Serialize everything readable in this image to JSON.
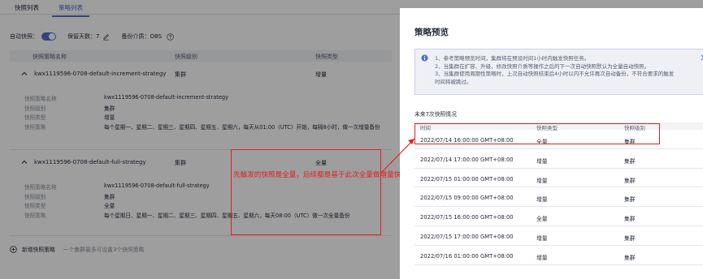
{
  "tabs": [
    {
      "label": "快照列表"
    },
    {
      "label": "策略列表"
    }
  ],
  "settings": {
    "auto_label": "自动快照：",
    "keep_label": "保留天数：",
    "keep_value": "7",
    "medium_label": "备份介质：",
    "medium_value": "OBS"
  },
  "table_header": {
    "name": "快照策略名称",
    "level": "快照级别",
    "type": "快照类型"
  },
  "groups": [
    {
      "name": "kwx1119596-0708-default-increment-strategy",
      "level": "集群",
      "type": "增量",
      "details": [
        {
          "k": "快照策略名称",
          "v": "kwx1119596-0708-default-increment-strategy"
        },
        {
          "k": "快照级别",
          "v": "集群"
        },
        {
          "k": "快照类型",
          "v": "增量"
        },
        {
          "k": "快照策略",
          "v": "每个星期一、星期二、星期三、星期四、星期五、星期六，每天从01:00（UTC）开始，每隔8小时，做一次增量备份"
        }
      ]
    },
    {
      "name": "kwx1119596-0708-default-full-strategy",
      "level": "集群",
      "type": "全量",
      "details": [
        {
          "k": "快照策略名称",
          "v": "kwx1119596-0708-default-full-strategy"
        },
        {
          "k": "快照级别",
          "v": "集群"
        },
        {
          "k": "快照类型",
          "v": "全量"
        },
        {
          "k": "快照策略",
          "v": "每个星期日、星期一、星期二、星期三、星期四、星期五、星期六，每天08:00（UTC）做一次全量备份"
        }
      ]
    }
  ],
  "add": {
    "label": "新增快照策略",
    "hint": "一个集群最多可设置3个快照策略"
  },
  "annotation": "先触发的快照是全量，后续都是基于此次全量做增量快照",
  "drawer": {
    "title": "策略预览",
    "notes": [
      "1、参考策略预览时间，集群将在预设时间1小时内触发快照任务。",
      "2、当集群在扩容、升级、修改快照介质等操作之后的下一次自动快照默认为全量自动快照。",
      "3、当集群使用周期性策略时，上次自动快照结束后4小时以内不允许再次自动备份，不符合要求的触发",
      "时间将被跳过。"
    ],
    "subtitle": "未来7次快照情况",
    "columns": {
      "time": "时间",
      "type": "快照类型",
      "level": "快照级别"
    },
    "rows": [
      {
        "time": "2022/07/14 16:00:00 GMT+08:00",
        "type": "全量",
        "level": "集群"
      },
      {
        "time": "2022/07/14 17:00:00 GMT+08:00",
        "type": "增量",
        "level": "集群"
      },
      {
        "time": "2022/07/15 01:00:00 GMT+08:00",
        "type": "增量",
        "level": "集群"
      },
      {
        "time": "2022/07/15 09:00:00 GMT+08:00",
        "type": "增量",
        "level": "集群"
      },
      {
        "time": "2022/07/15 16:00:00 GMT+08:00",
        "type": "全量",
        "level": "集群"
      },
      {
        "time": "2022/07/15 17:00:00 GMT+08:00",
        "type": "增量",
        "level": "集群"
      },
      {
        "time": "2022/07/16 01:00:00 GMT+08:00",
        "type": "增量",
        "level": "集群"
      }
    ]
  },
  "colors": {
    "accent": "#526ecc",
    "annotation": "#e02020"
  }
}
